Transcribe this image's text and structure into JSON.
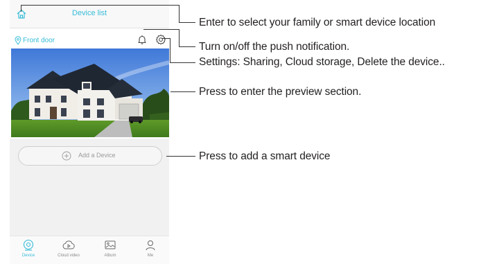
{
  "header": {
    "title": "Device list",
    "home_icon": "home-icon"
  },
  "device": {
    "name": "Front door",
    "location_icon": "location-pin-icon",
    "notification_icon": "bell-icon",
    "settings_icon": "gear-icon"
  },
  "add_device": {
    "label": "Add a Device",
    "icon": "plus-circle-icon"
  },
  "tabs": [
    {
      "label": "Device",
      "icon": "camera-icon",
      "active": true
    },
    {
      "label": "Cloud video",
      "icon": "cloud-play-icon",
      "active": false
    },
    {
      "label": "Album",
      "icon": "image-icon",
      "active": false
    },
    {
      "label": "Me",
      "icon": "person-icon",
      "active": false
    }
  ],
  "annotations": {
    "family": "Enter to select your family or smart device location",
    "push": "Turn on/off the push notification.",
    "settings": "Settings: Sharing, Cloud storage, Delete the device..",
    "preview": "Press to enter the preview section.",
    "add": "Press to add a smart device"
  },
  "colors": {
    "accent": "#35bcd8",
    "text": "#231f20",
    "muted": "#9a9a9a"
  }
}
